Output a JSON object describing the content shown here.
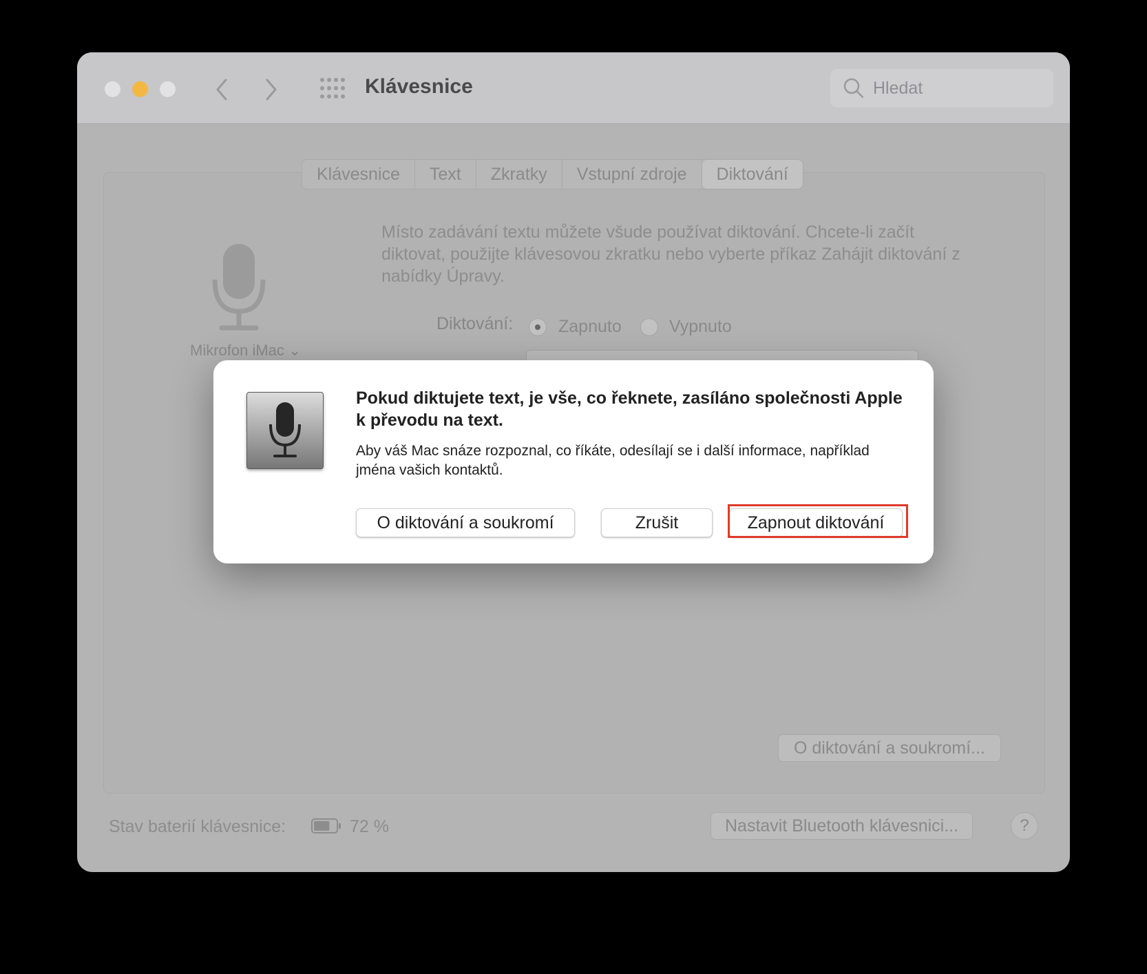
{
  "window": {
    "title": "Klávesnice",
    "search_placeholder": "Hledat"
  },
  "tabs": [
    {
      "label": "Klávesnice",
      "active": false
    },
    {
      "label": "Text",
      "active": false
    },
    {
      "label": "Zkratky",
      "active": false
    },
    {
      "label": "Vstupní zdroje",
      "active": false
    },
    {
      "label": "Diktování",
      "active": true
    }
  ],
  "dictation": {
    "mic_source": "Mikrofon iMac",
    "description": "Místo zadávání textu můžete všude používat diktování. Chcete-li začít diktovat, použijte klávesovou zkratku nebo vyberte příkaz Zahájit diktování z nabídky Úpravy.",
    "label": "Diktování:",
    "on_label": "Zapnuto",
    "off_label": "Vypnuto",
    "selected": "Zapnuto",
    "privacy_button": "O diktování a soukromí..."
  },
  "footer": {
    "battery_label": "Stav baterií klávesnice:",
    "battery_value": "72 %",
    "battery_level_percent": 72,
    "bluetooth_button": "Nastavit Bluetooth klávesnici...",
    "help": "?"
  },
  "dialog": {
    "title": "Pokud diktujete text, je vše, co řeknete, zasíláno společnosti Apple k převodu na text.",
    "message": "Aby váš Mac snáze rozpoznal, co říkáte, odesílají se i další informace, například jména vašich kontaktů.",
    "about_button": "O diktování a soukromí",
    "cancel_button": "Zrušit",
    "enable_button": "Zapnout diktování"
  },
  "colors": {
    "highlight": "#e03a2b",
    "traffic_yellow": "#f3b843"
  },
  "icons": {
    "back": "chevron-left-icon",
    "forward": "chevron-right-icon",
    "grid": "grid-icon",
    "search": "search-icon",
    "microphone": "microphone-icon",
    "battery": "battery-icon"
  }
}
